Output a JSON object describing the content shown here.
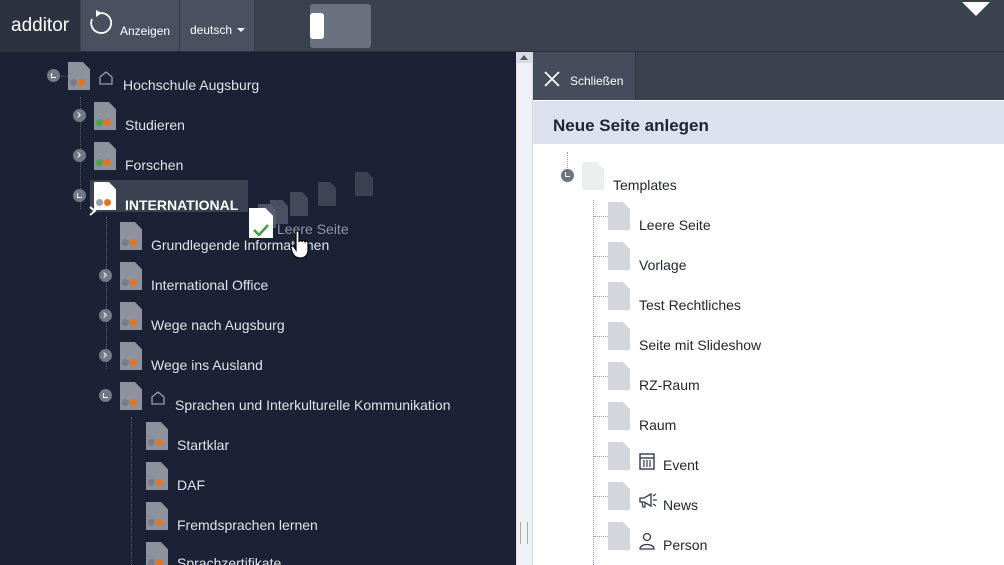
{
  "app": {
    "title": "additor"
  },
  "toolbar": {
    "show_label": "Anzeigen",
    "language_label": "deutsch"
  },
  "tree": {
    "root": {
      "label": "Hochschule Augsburg"
    },
    "items": [
      {
        "label": "Studieren"
      },
      {
        "label": "Forschen"
      },
      {
        "label": "INTERNATIONAL"
      },
      {
        "label": "Grundlegende Informationen"
      },
      {
        "label": "International Office"
      },
      {
        "label": "Wege nach Augsburg"
      },
      {
        "label": "Wege ins Ausland"
      },
      {
        "label": "Sprachen und Interkulturelle Kommunikation"
      },
      {
        "label": "Startklar"
      },
      {
        "label": "DAF"
      },
      {
        "label": "Fremdsprachen lernen"
      },
      {
        "label": "Sprachzertifikate"
      }
    ],
    "drag_label": "Leere Seite"
  },
  "panel": {
    "close_label": "Schließen",
    "title": "Neue Seite anlegen",
    "root_label": "Templates",
    "templates": [
      {
        "label": "Leere Seite",
        "icon": ""
      },
      {
        "label": "Vorlage",
        "icon": ""
      },
      {
        "label": "Test Rechtliches",
        "icon": ""
      },
      {
        "label": "Seite mit Slideshow",
        "icon": ""
      },
      {
        "label": "RZ-Raum",
        "icon": ""
      },
      {
        "label": "Raum",
        "icon": ""
      },
      {
        "label": "Event",
        "icon": "calendar-icon"
      },
      {
        "label": "News",
        "icon": "megaphone-icon"
      },
      {
        "label": "Person",
        "icon": "person-icon"
      }
    ]
  },
  "colors": {
    "tree_background": "#1b2236",
    "topbar": "#3a414f",
    "status_orange": "#e8731a",
    "status_green": "#4aa83c",
    "panel_title_bg": "#dde1ee"
  }
}
